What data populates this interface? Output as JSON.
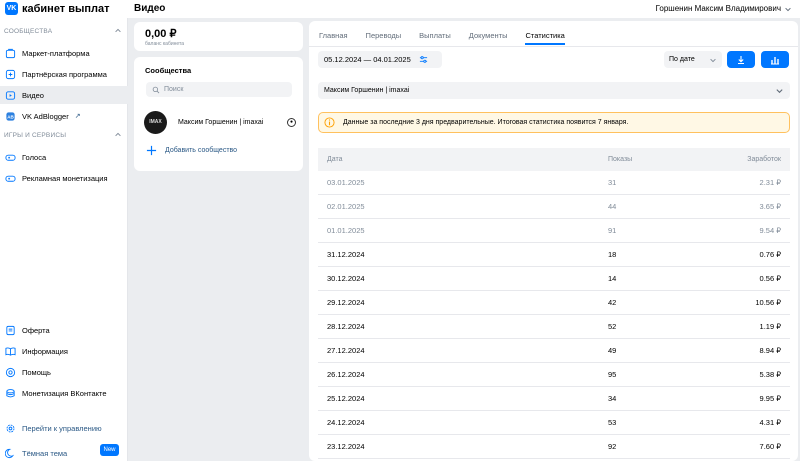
{
  "app": {
    "logo_badge": "VK",
    "logo_text": "кабинет выплат",
    "page_title": "Видео",
    "user_name": "Горшенин Максим Владимирович"
  },
  "sidebar": {
    "section_communities": "СООБЩЕСТВА",
    "items_top": [
      {
        "label": "Маркет-платформа",
        "icon": "market-icon"
      },
      {
        "label": "Партнёрская программа",
        "icon": "partner-icon"
      },
      {
        "label": "Видео",
        "icon": "video-icon"
      },
      {
        "label": "VK AdBlogger",
        "icon": "adblogger-icon"
      }
    ],
    "section_games": "ИГРЫ И СЕРВИСЫ",
    "items_games": [
      {
        "label": "Голоса",
        "icon": "gamepad-icon"
      },
      {
        "label": "Рекламная монетизация",
        "icon": "gamepad-icon"
      }
    ],
    "items_bottom": [
      {
        "label": "Оферта",
        "icon": "document-icon"
      },
      {
        "label": "Информация",
        "icon": "book-icon"
      },
      {
        "label": "Помощь",
        "icon": "help-icon"
      },
      {
        "label": "Монетизация ВКонтакте",
        "icon": "coins-icon"
      }
    ],
    "manage_link": "Перейти к управлению",
    "dark_theme": "Тёмная тема",
    "new_badge": "New"
  },
  "balance": {
    "amount": "0,00 ₽",
    "label": "баланс кабинета"
  },
  "communities": {
    "title": "Сообщества",
    "search_placeholder": "Поиск",
    "items": [
      {
        "name": "Максим Горшенин | imaxai",
        "avatar_text": "IMAX"
      }
    ],
    "add_label": "Добавить сообщество"
  },
  "tabs": [
    "Главная",
    "Переводы",
    "Выплаты",
    "Документы",
    "Статистика"
  ],
  "active_tab": "Статистика",
  "filters": {
    "date_range": "05.12.2024 — 04.01.2025",
    "sort": "По дате",
    "community": "Максим Горшенин | imaxai"
  },
  "notice": "Данные за последние 3 дня предварительные. Итоговая статистика появится 7 января.",
  "table": {
    "headers": {
      "date": "Дата",
      "views": "Показы",
      "earnings": "Заработок"
    },
    "rows": [
      {
        "date": "03.01.2025",
        "views": "31",
        "earnings": "2.31 ₽",
        "prelim": true
      },
      {
        "date": "02.01.2025",
        "views": "44",
        "earnings": "3.65 ₽",
        "prelim": true
      },
      {
        "date": "01.01.2025",
        "views": "91",
        "earnings": "9.54 ₽",
        "prelim": true
      },
      {
        "date": "31.12.2024",
        "views": "18",
        "earnings": "0.76 ₽",
        "prelim": false
      },
      {
        "date": "30.12.2024",
        "views": "14",
        "earnings": "0.56 ₽",
        "prelim": false
      },
      {
        "date": "29.12.2024",
        "views": "42",
        "earnings": "10.56 ₽",
        "prelim": false
      },
      {
        "date": "28.12.2024",
        "views": "52",
        "earnings": "1.19 ₽",
        "prelim": false
      },
      {
        "date": "27.12.2024",
        "views": "49",
        "earnings": "8.94 ₽",
        "prelim": false
      },
      {
        "date": "26.12.2024",
        "views": "95",
        "earnings": "5.38 ₽",
        "prelim": false
      },
      {
        "date": "25.12.2024",
        "views": "34",
        "earnings": "9.95 ₽",
        "prelim": false
      },
      {
        "date": "24.12.2024",
        "views": "53",
        "earnings": "4.31 ₽",
        "prelim": false
      },
      {
        "date": "23.12.2024",
        "views": "92",
        "earnings": "7.60 ₽",
        "prelim": false
      }
    ]
  },
  "colors": {
    "accent": "#0077ff",
    "link": "#2a5885",
    "muted": "#818c99",
    "notice_bg": "#fff8e5",
    "notice_border": "#ffc15e"
  }
}
